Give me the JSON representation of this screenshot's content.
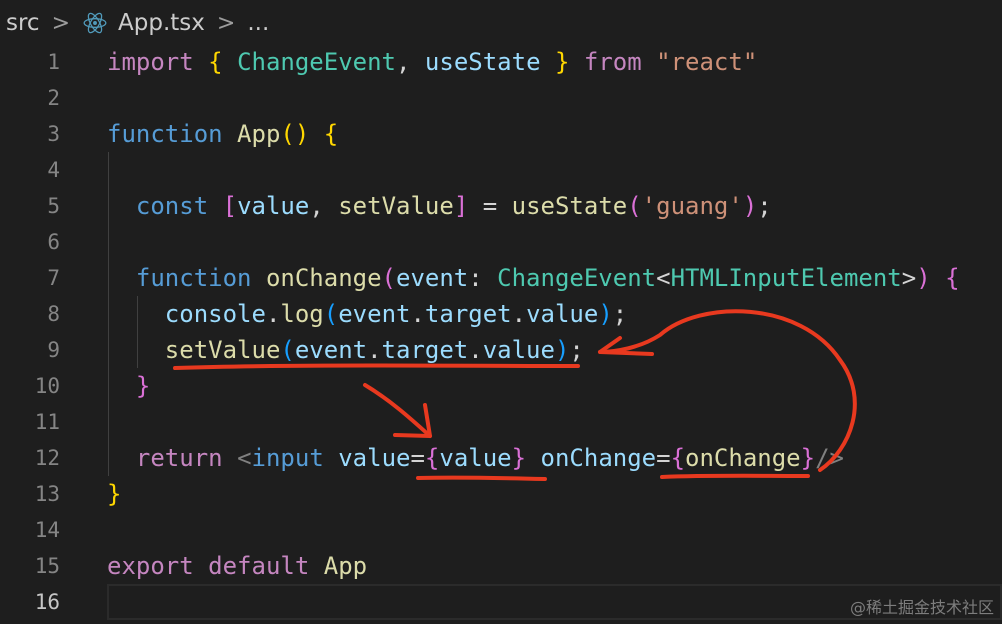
{
  "breadcrumb": {
    "folder": "src",
    "file": "App.tsx",
    "more": "...",
    "separator": ">"
  },
  "editor": {
    "active_line": 16,
    "lines": [
      {
        "n": "1",
        "tokens": [
          {
            "t": "import",
            "c": "k"
          },
          {
            "t": " "
          },
          {
            "t": "{",
            "c": "p1"
          },
          {
            "t": " "
          },
          {
            "t": "ChangeEvent",
            "c": "ty"
          },
          {
            "t": ", "
          },
          {
            "t": "useState",
            "c": "var"
          },
          {
            "t": " "
          },
          {
            "t": "}",
            "c": "p1"
          },
          {
            "t": " "
          },
          {
            "t": "from",
            "c": "k"
          },
          {
            "t": " "
          },
          {
            "t": "\"react\"",
            "c": "st"
          }
        ]
      },
      {
        "n": "2",
        "tokens": []
      },
      {
        "n": "3",
        "tokens": [
          {
            "t": "function",
            "c": "kw"
          },
          {
            "t": " "
          },
          {
            "t": "App",
            "c": "fn"
          },
          {
            "t": "()",
            "c": "p1"
          },
          {
            "t": " "
          },
          {
            "t": "{",
            "c": "p1"
          }
        ]
      },
      {
        "n": "4",
        "tokens": []
      },
      {
        "n": "5",
        "tokens": [
          {
            "t": "  "
          },
          {
            "t": "const",
            "c": "kw"
          },
          {
            "t": " "
          },
          {
            "t": "[",
            "c": "p2"
          },
          {
            "t": "value",
            "c": "var"
          },
          {
            "t": ", "
          },
          {
            "t": "setValue",
            "c": "fn"
          },
          {
            "t": "]",
            "c": "p2"
          },
          {
            "t": " = "
          },
          {
            "t": "useState",
            "c": "fn"
          },
          {
            "t": "(",
            "c": "p2"
          },
          {
            "t": "'guang'",
            "c": "st"
          },
          {
            "t": ")",
            "c": "p2"
          },
          {
            "t": ";"
          }
        ]
      },
      {
        "n": "6",
        "tokens": []
      },
      {
        "n": "7",
        "tokens": [
          {
            "t": "  "
          },
          {
            "t": "function",
            "c": "kw"
          },
          {
            "t": " "
          },
          {
            "t": "onChange",
            "c": "fn"
          },
          {
            "t": "(",
            "c": "p2"
          },
          {
            "t": "event",
            "c": "var"
          },
          {
            "t": ": "
          },
          {
            "t": "ChangeEvent",
            "c": "ty"
          },
          {
            "t": "<",
            "c": "pl"
          },
          {
            "t": "HTMLInputElement",
            "c": "ty"
          },
          {
            "t": ">",
            "c": "pl"
          },
          {
            "t": ")",
            "c": "p2"
          },
          {
            "t": " "
          },
          {
            "t": "{",
            "c": "p2"
          }
        ]
      },
      {
        "n": "8",
        "tokens": [
          {
            "t": "    "
          },
          {
            "t": "console",
            "c": "var"
          },
          {
            "t": "."
          },
          {
            "t": "log",
            "c": "fn"
          },
          {
            "t": "(",
            "c": "p3"
          },
          {
            "t": "event",
            "c": "var"
          },
          {
            "t": "."
          },
          {
            "t": "target",
            "c": "var"
          },
          {
            "t": "."
          },
          {
            "t": "value",
            "c": "var"
          },
          {
            "t": ")",
            "c": "p3"
          },
          {
            "t": ";"
          }
        ]
      },
      {
        "n": "9",
        "tokens": [
          {
            "t": "    "
          },
          {
            "t": "setValue",
            "c": "fn"
          },
          {
            "t": "(",
            "c": "p3"
          },
          {
            "t": "event",
            "c": "var"
          },
          {
            "t": "."
          },
          {
            "t": "target",
            "c": "var"
          },
          {
            "t": "."
          },
          {
            "t": "value",
            "c": "var"
          },
          {
            "t": ")",
            "c": "p3"
          },
          {
            "t": ";"
          }
        ]
      },
      {
        "n": "10",
        "tokens": [
          {
            "t": "  "
          },
          {
            "t": "}",
            "c": "p2"
          }
        ]
      },
      {
        "n": "11",
        "tokens": []
      },
      {
        "n": "12",
        "tokens": [
          {
            "t": "  "
          },
          {
            "t": "return",
            "c": "k"
          },
          {
            "t": " "
          },
          {
            "t": "<",
            "c": "tg"
          },
          {
            "t": "input",
            "c": "kw"
          },
          {
            "t": " "
          },
          {
            "t": "value",
            "c": "var"
          },
          {
            "t": "="
          },
          {
            "t": "{",
            "c": "p2"
          },
          {
            "t": "value",
            "c": "var"
          },
          {
            "t": "}",
            "c": "p2"
          },
          {
            "t": " "
          },
          {
            "t": "onChange",
            "c": "var"
          },
          {
            "t": "="
          },
          {
            "t": "{",
            "c": "p2"
          },
          {
            "t": "onChange",
            "c": "fn"
          },
          {
            "t": "}",
            "c": "p2"
          },
          {
            "t": "/>",
            "c": "tg"
          }
        ]
      },
      {
        "n": "13",
        "tokens": [
          {
            "t": "}",
            "c": "p1"
          }
        ]
      },
      {
        "n": "14",
        "tokens": []
      },
      {
        "n": "15",
        "tokens": [
          {
            "t": "export",
            "c": "k"
          },
          {
            "t": " "
          },
          {
            "t": "default",
            "c": "k"
          },
          {
            "t": " "
          },
          {
            "t": "App",
            "c": "fn"
          }
        ]
      },
      {
        "n": "16",
        "tokens": []
      }
    ]
  },
  "watermark": "@稀土掘金技术社区",
  "colors": {
    "background": "#1e1e1e",
    "annotation": "#e8391f"
  }
}
